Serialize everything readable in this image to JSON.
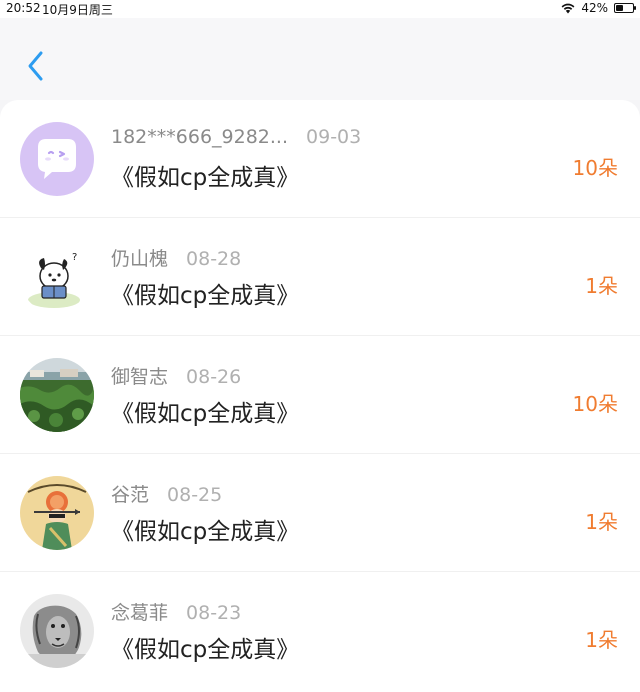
{
  "status_bar": {
    "time": "20:52",
    "date": "10月9日周三",
    "battery_percent": "42%",
    "battery_level": 0.42
  },
  "header": {
    "back_icon": "chevron-left-icon",
    "accent_color": "#2d9cf0"
  },
  "entries": [
    {
      "name": "182***666_9282...",
      "date": "09-03",
      "title": "《假如cp全成真》",
      "count": "10朵",
      "avatar": "purple-chat-bubble-avatar"
    },
    {
      "name": "仍山槐",
      "date": "08-28",
      "title": "《假如cp全成真》",
      "count": "1朵",
      "avatar": "cartoon-dog-reading-avatar"
    },
    {
      "name": "御智志",
      "date": "08-26",
      "title": "《假如cp全成真》",
      "count": "10朵",
      "avatar": "crop-field-photo-avatar"
    },
    {
      "name": "谷范",
      "date": "08-25",
      "title": "《假如cp全成真》",
      "count": "1朵",
      "avatar": "sagittarius-illustration-avatar"
    },
    {
      "name": "念葛菲",
      "date": "08-23",
      "title": "《假如cp全成真》",
      "count": "1朵",
      "avatar": "lion-sketch-avatar"
    }
  ],
  "colors": {
    "count": "#f07c30",
    "title": "#222222",
    "meta": "#8a8a8a"
  }
}
